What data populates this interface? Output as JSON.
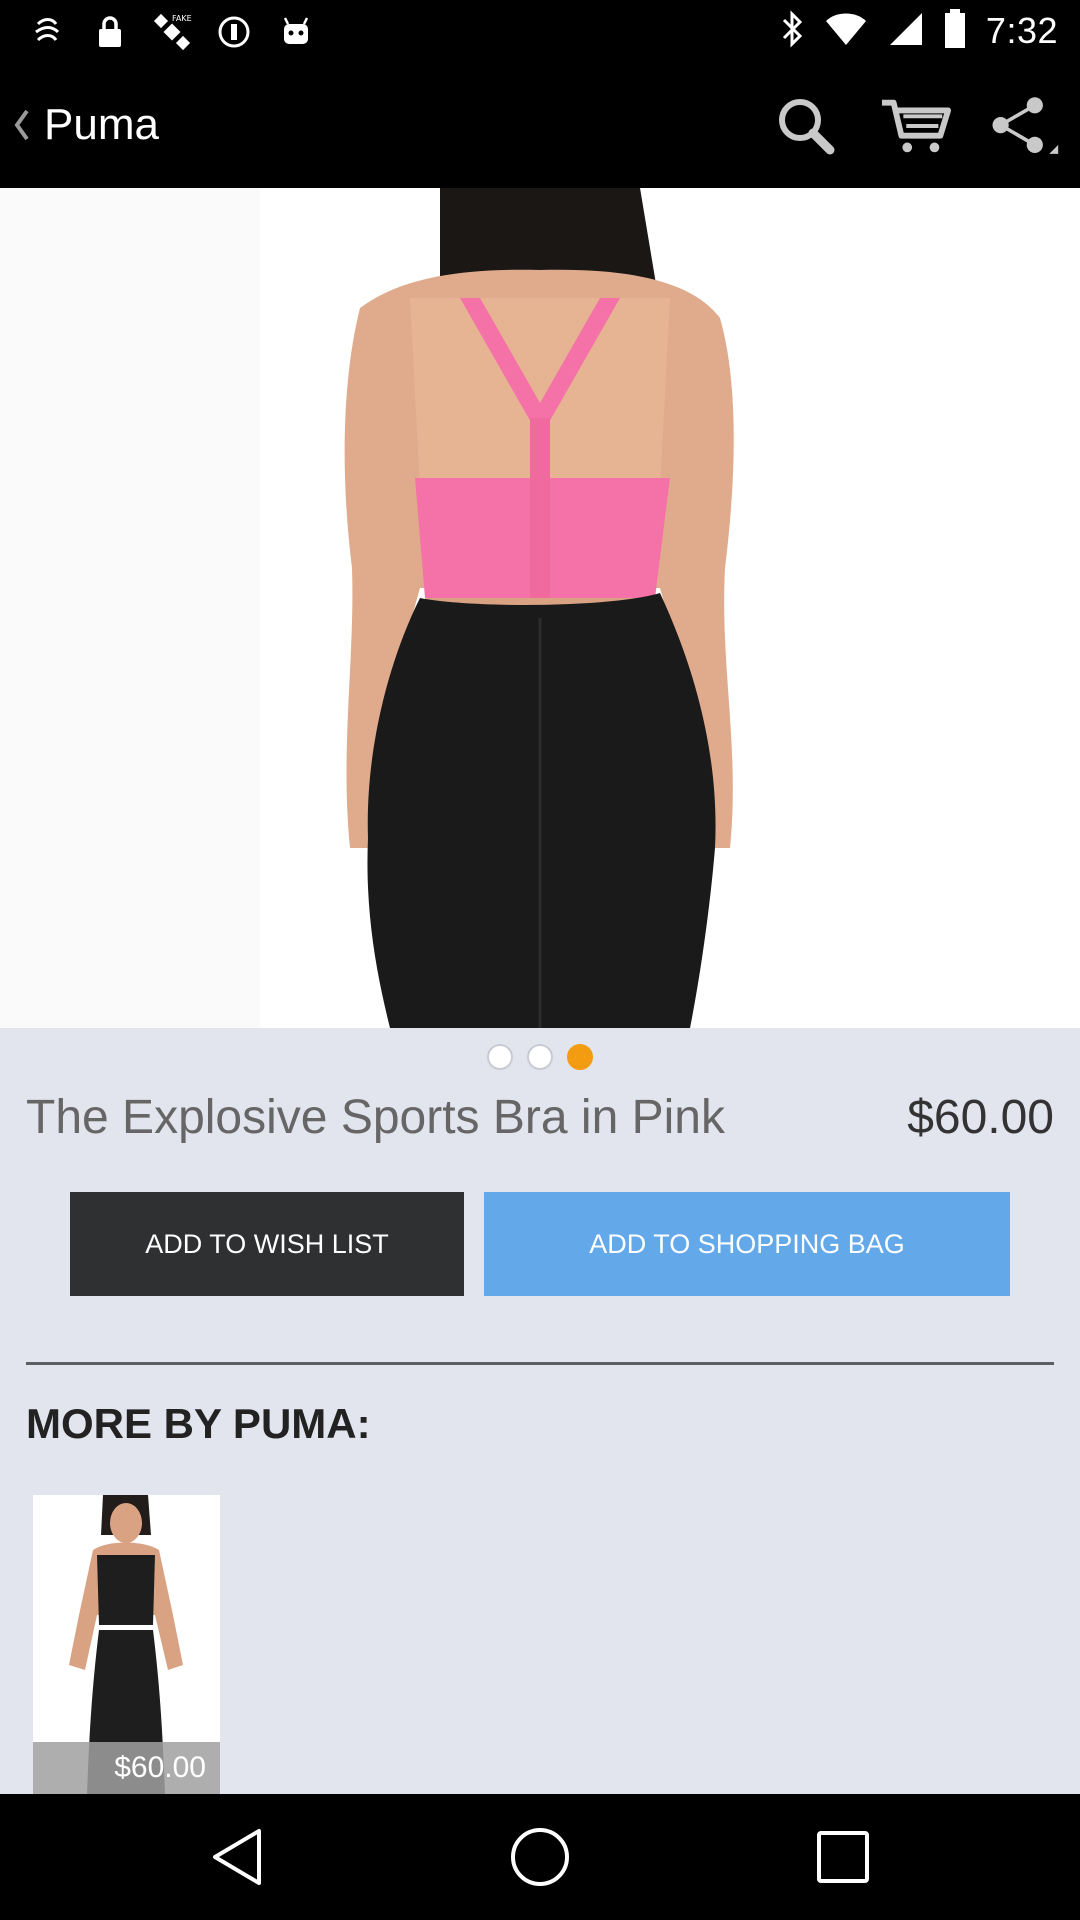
{
  "status_bar": {
    "time": "7:32",
    "left_icons": [
      "notification-icon",
      "lock-icon",
      "fake-gps-icon",
      "sync-icon",
      "android-icon"
    ],
    "right_icons": [
      "bluetooth-icon",
      "wifi-icon",
      "signal-icon",
      "battery-icon"
    ]
  },
  "action_bar": {
    "title": "Puma",
    "icons": [
      "search-icon",
      "cart-icon",
      "share-icon"
    ]
  },
  "carousel": {
    "total": 3,
    "active_index": 2,
    "active_color": "#f39c12"
  },
  "product": {
    "name": "The Explosive Sports Bra in Pink",
    "price": "$60.00"
  },
  "buttons": {
    "wish_label": "ADD TO WISH LIST",
    "bag_label": "ADD TO SHOPPING BAG",
    "bag_color": "#63a8e9",
    "wish_color": "#2f3031"
  },
  "more": {
    "title": "MORE BY PUMA:",
    "items": [
      {
        "price": "$60.00"
      }
    ]
  },
  "nav_bar": {
    "icons": [
      "back-nav-icon",
      "home-nav-icon",
      "recents-nav-icon"
    ]
  }
}
